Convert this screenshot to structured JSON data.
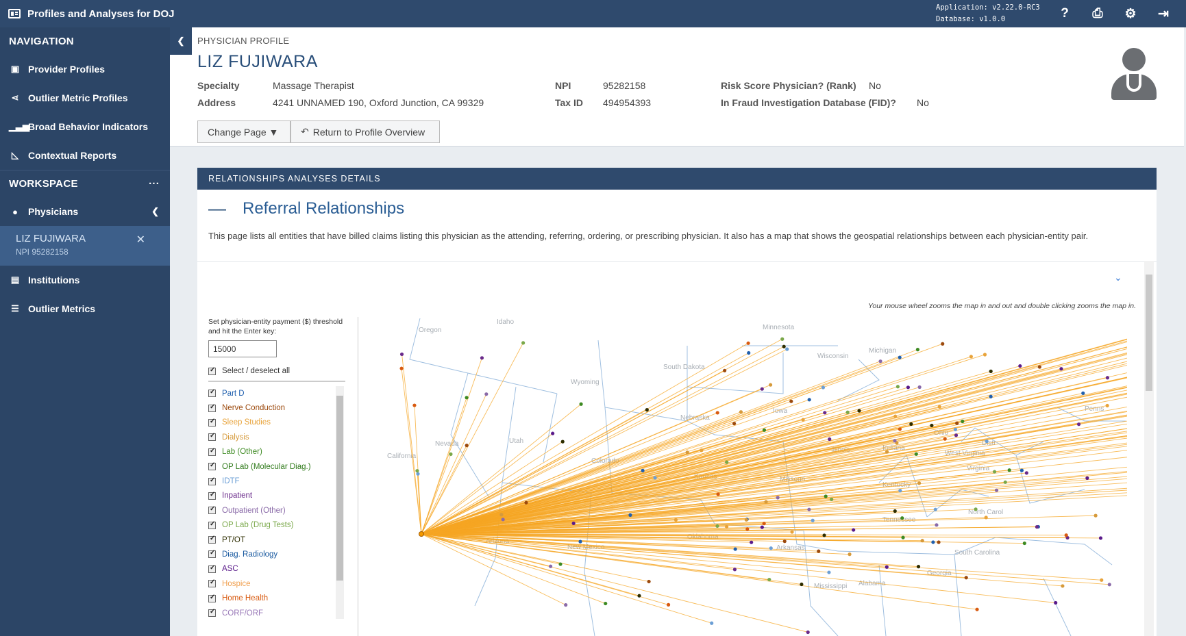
{
  "app": {
    "title": "Profiles and Analyses for DOJ",
    "app_version": "Application: v2.22.0-RC3",
    "db_version": "Database: v1.0.0",
    "icons": [
      "help-icon",
      "print-icon",
      "user-settings-icon",
      "logout-icon"
    ]
  },
  "sidebar": {
    "navigation_title": "NAVIGATION",
    "nav_items": [
      {
        "label": "Provider Profiles",
        "icon": "id-card-icon"
      },
      {
        "label": "Outlier Metric Profiles",
        "icon": "share-icon"
      },
      {
        "label": "Broad Behavior Indicators",
        "icon": "signal-icon"
      },
      {
        "label": "Contextual Reports",
        "icon": "area-chart-icon"
      }
    ],
    "workspace_title": "WORKSPACE",
    "workspace_more": "···",
    "physicians_label": "Physicians",
    "active_profile": {
      "name": "LIZ FUJIWARA",
      "npi": "NPI 95282158"
    },
    "bottom_items": [
      {
        "label": "Institutions",
        "icon": "building-icon"
      },
      {
        "label": "Outlier Metrics",
        "icon": "sliders-icon"
      }
    ]
  },
  "profile": {
    "breadcrumb": "PHYSICIAN PROFILE",
    "name": "LIZ FUJIWARA",
    "specialty_label": "Specialty",
    "specialty": "Massage Therapist",
    "address_label": "Address",
    "address": "4241 UNNAMED 190, Oxford Junction, CA 99329",
    "npi_label": "NPI",
    "npi": "95282158",
    "taxid_label": "Tax ID",
    "taxid": "494954393",
    "risk_label": "Risk Score Physician? (Rank)",
    "risk": "No",
    "fid_label": "In Fraud Investigation Database (FID)?",
    "fid": "No",
    "change_page": "Change Page ▼",
    "return_btn": "Return to Profile Overview"
  },
  "section": {
    "header": "RELATIONSHIPS ANALYSES DETAILS",
    "title": "Referral Relationships",
    "description": "This page lists all entities that have billed claims listing this physician as the attending, referring, ordering, or prescribing physician. It also has a map that shows the geospatial relationships between each physician-entity pair.",
    "map_note": "Your mouse wheel zooms the map in and out and double clicking zooms the map in.",
    "threshold_note": "Set physician-entity payment ($) threshold and hit the Enter key:",
    "threshold_value": "15000",
    "select_all": "Select / deselect all",
    "filters": [
      {
        "label": "Part D",
        "color": "#1f5fae"
      },
      {
        "label": "Nerve Conduction",
        "color": "#9c4a0e"
      },
      {
        "label": "Sleep Studies",
        "color": "#e8a33a"
      },
      {
        "label": "Dialysis",
        "color": "#d69a3b"
      },
      {
        "label": "Lab (Other)",
        "color": "#3d8a22"
      },
      {
        "label": "OP Lab (Molecular Diag.)",
        "color": "#2f7a1a"
      },
      {
        "label": "IDTF",
        "color": "#6b9fd6"
      },
      {
        "label": "Inpatient",
        "color": "#6a2a8a"
      },
      {
        "label": "Outpatient (Other)",
        "color": "#8a6aa8"
      },
      {
        "label": "OP Lab (Drug Tests)",
        "color": "#7aa84a"
      },
      {
        "label": "PT/OT",
        "color": "#2d2d00"
      },
      {
        "label": "Diag. Radiology",
        "color": "#1a5aa0"
      },
      {
        "label": "ASC",
        "color": "#5a1a8a"
      },
      {
        "label": "Hospice",
        "color": "#f0a050"
      },
      {
        "label": "Home Health",
        "color": "#d85a10"
      },
      {
        "label": "CORF/ORF",
        "color": "#9a7ab8"
      }
    ],
    "map_labels": [
      "Oregon",
      "Idaho",
      "Minnesota",
      "Wisconsin",
      "Michigan",
      "South Dakota",
      "Wyoming",
      "Nebraska",
      "Iowa",
      "Nevada",
      "Utah",
      "California",
      "Colorado",
      "Illinois",
      "Indiana",
      "Ohio",
      "Penns",
      "Kansas",
      "Missouri",
      "Kentucky",
      "West Virginia",
      "Virginia",
      "Tennessee",
      "North Carol",
      "Oklahoma",
      "Arizona",
      "New Mexico",
      "Arkansas",
      "South Carolina",
      "Georgia",
      "Alabama",
      "Mississippi",
      "Distr"
    ],
    "origin_color": "#f59a00",
    "line_color": "#f5a623"
  }
}
